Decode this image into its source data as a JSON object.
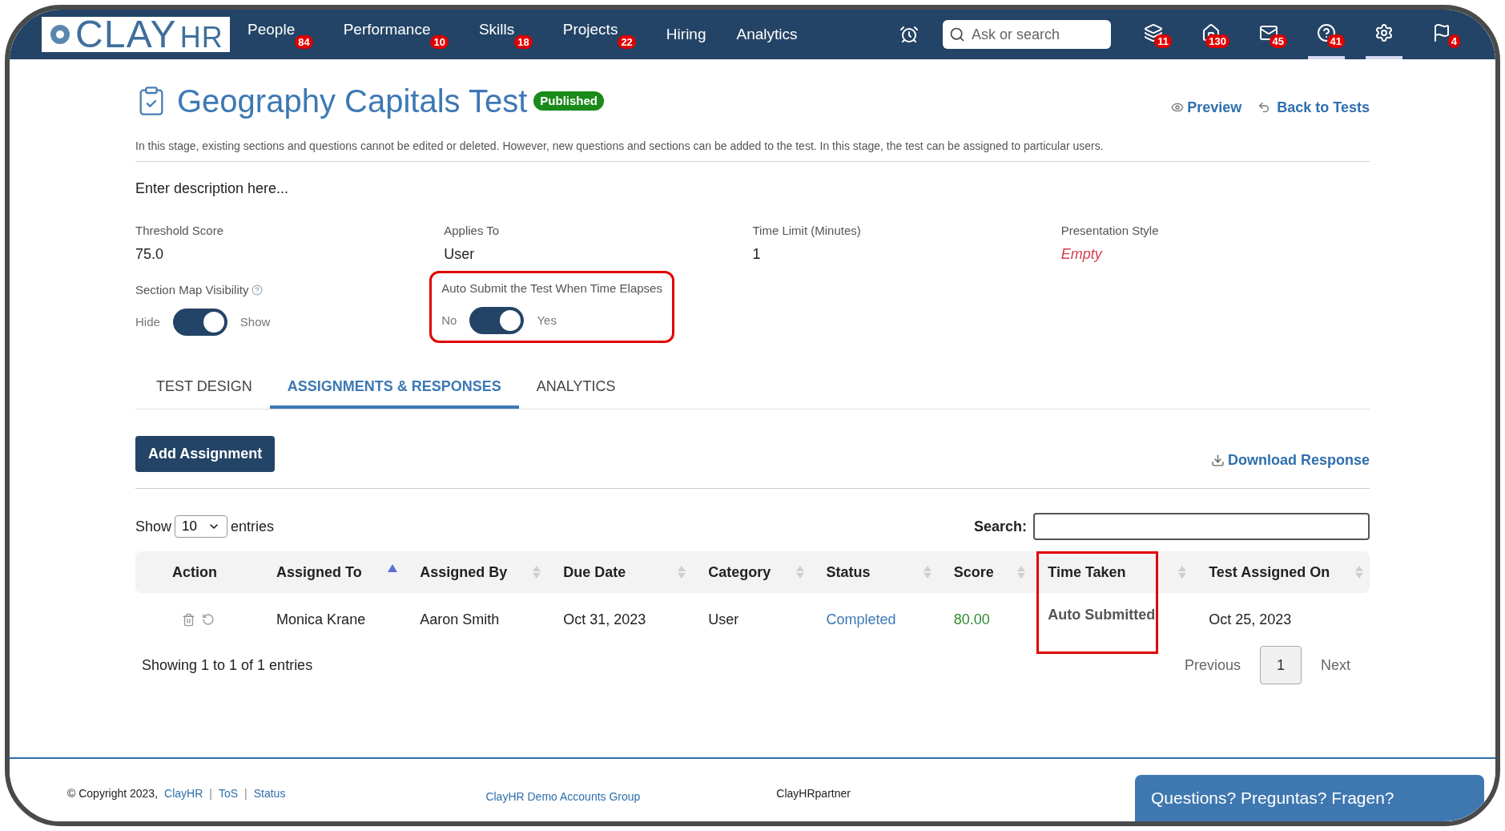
{
  "nav": {
    "logo": {
      "main": "CLAY",
      "sub": "HR"
    },
    "items": [
      {
        "label": "People",
        "badge": "84"
      },
      {
        "label": "Performance",
        "badge": "10"
      },
      {
        "label": "Skills",
        "badge": "18"
      },
      {
        "label": "Projects",
        "badge": "22"
      },
      {
        "label": "Hiring"
      },
      {
        "label": "Analytics"
      }
    ],
    "search": {
      "placeholder": "Ask or search"
    },
    "icons": [
      {
        "kind": "courses",
        "badge": "11",
        "selected": false
      },
      {
        "kind": "home",
        "badge": "130",
        "selected": false
      },
      {
        "kind": "mail",
        "badge": "45",
        "selected": false
      },
      {
        "kind": "help",
        "badge": "41",
        "selected": true
      },
      {
        "kind": "settings",
        "selected": true
      },
      {
        "kind": "flag",
        "badge": "4",
        "selected": false
      }
    ]
  },
  "page": {
    "title": "Geography Capitals Test",
    "status": "Published",
    "actions": [
      "Preview",
      "Back to Tests"
    ],
    "notice": "In this stage, existing sections and questions cannot be edited or deleted. However, new questions and sections can be added to the test. In this stage, the test can be assigned to particular users.",
    "description": "Enter description here...",
    "fields": [
      {
        "label": "Threshold Score",
        "value": "75.0",
        "empty": false
      },
      {
        "label": "Applies To",
        "value": "User",
        "empty": false
      },
      {
        "label": "Time Limit (Minutes)",
        "value": "1",
        "empty": false
      },
      {
        "label": "Presentation Style",
        "value": "Empty",
        "empty": true
      }
    ],
    "toggles": [
      {
        "label": "Section Map Visibility",
        "off_label": "Hide",
        "on_label": "Show",
        "on": true,
        "help": true,
        "highlighted": false
      },
      {
        "label": "Auto Submit the Test When Time Elapses",
        "off_label": "No",
        "on_label": "Yes",
        "on": true,
        "help": false,
        "highlighted": true
      }
    ]
  },
  "tabs": [
    {
      "label": "TEST DESIGN",
      "selected": false
    },
    {
      "label": "ASSIGNMENTS & RESPONSES",
      "selected": true
    },
    {
      "label": "ANALYTICS",
      "selected": false
    }
  ],
  "toolbar": {
    "add_button": "Add Assignment",
    "download": "Download Response"
  },
  "table": {
    "show_label": "Show",
    "page_size": "10",
    "entries_label": "entries",
    "search_label": "Search:",
    "columns": [
      {
        "label": "Action",
        "highlighted": false
      },
      {
        "label": "Assigned To",
        "sortable": true,
        "sorted": true,
        "highlighted": false
      },
      {
        "label": "Assigned By",
        "sortable": true,
        "sorted": false,
        "highlighted": false
      },
      {
        "label": "Due Date",
        "sortable": true,
        "sorted": false,
        "highlighted": false
      },
      {
        "label": "Category",
        "sortable": true,
        "sorted": false,
        "highlighted": false
      },
      {
        "label": "Status",
        "sortable": true,
        "sorted": false,
        "highlighted": false
      },
      {
        "label": "Score",
        "sortable": true,
        "sorted": false,
        "highlighted": false
      },
      {
        "label": "Time Taken",
        "sortable": true,
        "sorted": false,
        "highlighted": true
      },
      {
        "label": "Test Assigned On",
        "sortable": true,
        "sorted": false,
        "highlighted": false
      }
    ],
    "rows": [
      {
        "cells": [
          "",
          "Monica Krane",
          "Aaron Smith",
          "Oct 31, 2023",
          "User",
          "Completed",
          "80.00",
          "Auto Submitted",
          "Oct 25, 2023"
        ]
      }
    ],
    "info": "Showing 1 to 1 of 1 entries",
    "pagination": {
      "previous": "Previous",
      "pages": [
        {
          "label": "1",
          "selected": true
        }
      ],
      "next": "Next"
    }
  },
  "footer": {
    "copyright": "© Copyright 2023,",
    "links": [
      "ClayHR",
      "ToS",
      "Status"
    ],
    "separator": "|",
    "group": "ClayHR Demo Accounts Group",
    "partner": "ClayHRpartner",
    "chat": "Questions? Preguntas? Fragen?"
  }
}
